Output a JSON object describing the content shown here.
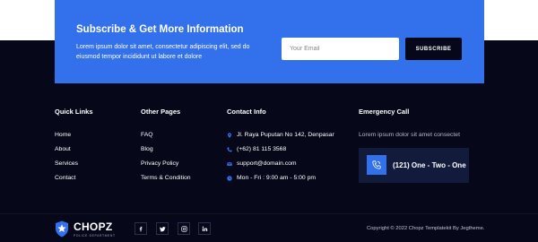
{
  "subscribe": {
    "title": "Subscribe & Get More Information",
    "description": "Lorem ipsum dolor sit amet, consectetur adipiscing elit, sed do eiusmod tempor incididunt ut labore et dolore",
    "email_placeholder": "Your Email",
    "button_label": "SUBSCRIBE",
    "accent_color": "#3370ec"
  },
  "quick_links": {
    "title": "Quick Links",
    "items": [
      "Home",
      "About",
      "Services",
      "Contact"
    ]
  },
  "other_pages": {
    "title": "Other Pages",
    "items": [
      "FAQ",
      "Blog",
      "Privacy Policy",
      "Terms & Condition"
    ]
  },
  "contact": {
    "title": "Contact Info",
    "items": [
      {
        "icon": "map-pin-icon",
        "text": "Jl. Raya Puputan No 142, Denpasar"
      },
      {
        "icon": "phone-icon",
        "text": "(+62) 81 115 3568"
      },
      {
        "icon": "mail-icon",
        "text": "support@domain.com"
      },
      {
        "icon": "clock-icon",
        "text": "Mon - Fri : 9:00 am - 5:00 pm"
      }
    ]
  },
  "emergency": {
    "title": "Emergency Call",
    "text": "Lorem ipsum dolor sit amet consectet",
    "number": "(121) One - Two - One"
  },
  "brand": {
    "name": "CHOPZ",
    "tagline": "POLICE DEPARTMENT"
  },
  "social": [
    {
      "icon": "facebook-icon",
      "label": "f"
    },
    {
      "icon": "twitter-icon",
      "label": "t"
    },
    {
      "icon": "instagram-icon",
      "label": "ig"
    },
    {
      "icon": "linkedin-icon",
      "label": "in"
    }
  ],
  "copyright": "Copyright © 2022 Chopz Templatekit By Jegtheme.",
  "colors": {
    "footer_bg": "#06081a",
    "accent": "#3370ec",
    "card_bg": "#131b3d"
  }
}
